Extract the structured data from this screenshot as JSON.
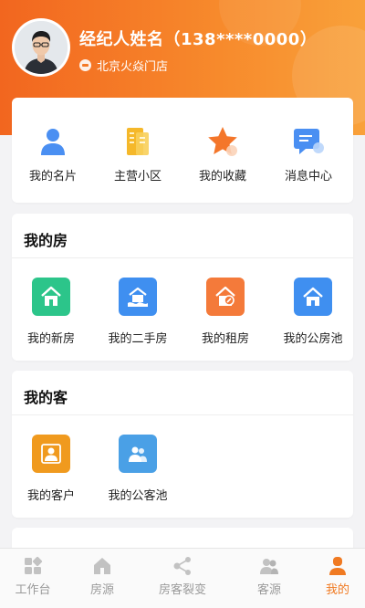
{
  "profile": {
    "name_line": "经纪人姓名（138****0000）",
    "store": "北京火焱门店",
    "store_icon": "store-badge-icon"
  },
  "quick_links": [
    {
      "label": "我的名片",
      "icon": "person-card-icon"
    },
    {
      "label": "主营小区",
      "icon": "building-icon"
    },
    {
      "label": "我的收藏",
      "icon": "star-icon"
    },
    {
      "label": "消息中心",
      "icon": "message-icon"
    }
  ],
  "house_section": {
    "title": "我的房",
    "items": [
      {
        "label": "我的新房",
        "icon": "new-house-icon",
        "color": "#2cc58a"
      },
      {
        "label": "我的二手房",
        "icon": "second-hand-house-icon",
        "color": "#3f8ff0"
      },
      {
        "label": "我的租房",
        "icon": "rent-house-icon",
        "color": "#f47a3a"
      },
      {
        "label": "我的公房池",
        "icon": "public-house-pool-icon",
        "color": "#3f8ff0"
      }
    ]
  },
  "client_section": {
    "title": "我的客",
    "items": [
      {
        "label": "我的客户",
        "icon": "client-icon",
        "color": "#f09a1e"
      },
      {
        "label": "我的公客池",
        "icon": "public-client-pool-icon",
        "color": "#4aa0e6"
      }
    ]
  },
  "tabbar": {
    "active_color": "#f07a22",
    "inactive_color": "#9a9a9a",
    "items": [
      {
        "label": "工作台",
        "icon": "workbench-icon"
      },
      {
        "label": "房源",
        "icon": "house-icon"
      },
      {
        "label": "房客裂变",
        "icon": "share-icon"
      },
      {
        "label": "客源",
        "icon": "people-icon"
      },
      {
        "label": "我的",
        "icon": "me-icon",
        "active": true
      }
    ]
  }
}
